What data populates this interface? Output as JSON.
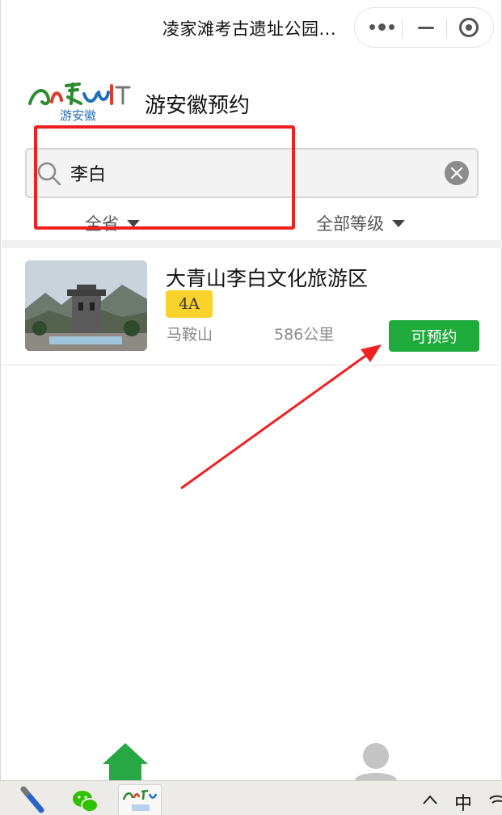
{
  "window": {
    "title": "凌家滩考古遗址公园..."
  },
  "capsule": {
    "more_icon": "more-dots-icon",
    "minimize_icon": "minimize-icon",
    "close_icon": "target-close-icon"
  },
  "header": {
    "logo_text": "游安徽",
    "app_name": "游安徽预约"
  },
  "search": {
    "value": "李白",
    "icon": "search-icon",
    "clear_icon": "clear-icon"
  },
  "filters": {
    "province": "全省",
    "level": "全部等级"
  },
  "results": [
    {
      "name": "大青山李白文化旅游区",
      "grade": "4A",
      "city": "马鞍山",
      "distance": "586公里",
      "action": "可预约"
    }
  ],
  "tabbar": {
    "home_icon": "home-icon",
    "user_icon": "user-icon"
  },
  "taskbar": {
    "ime": "中"
  },
  "colors": {
    "accent_green": "#1faa3c",
    "badge_yellow": "#f9d22b",
    "annotation_red": "#f02020"
  }
}
